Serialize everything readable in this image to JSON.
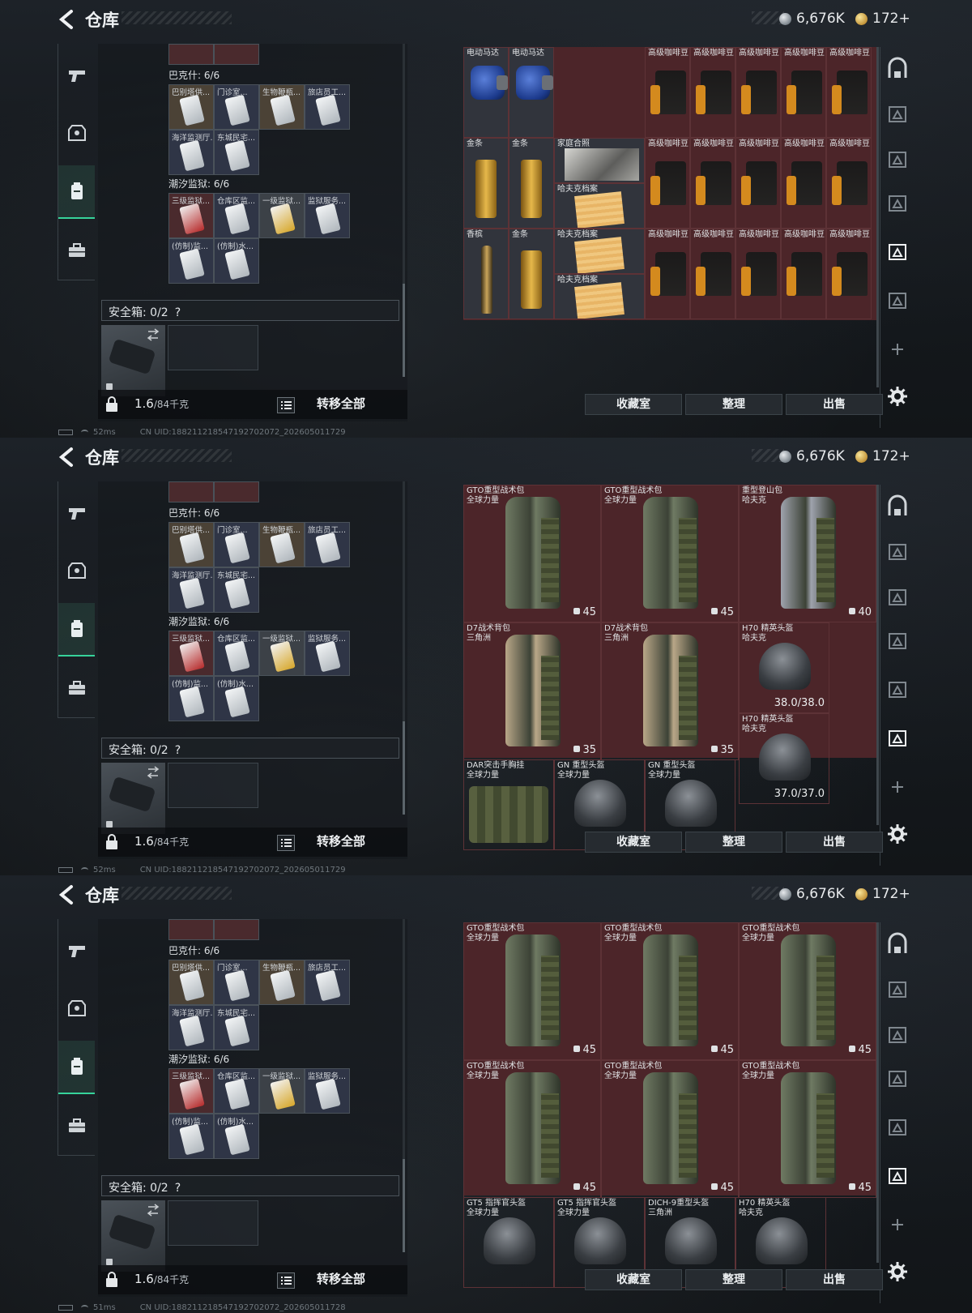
{
  "header": {
    "title": "仓库",
    "silver": "6,676K",
    "gold": "172+"
  },
  "storage": {
    "group_a": "巴克什: 6/6",
    "group_a_items": [
      "巴别塔供...",
      "门诊室...",
      "生物鞭瓶...",
      "旅店员工...",
      "海洋监测厅...",
      "东城民宅..."
    ],
    "group_b": "潮汐监狱: 6/6",
    "group_b_items": [
      "三级监狱...",
      "仓库区监...",
      "一级监狱...",
      "监狱服务...",
      "(仿制)监...",
      "(仿制)水..."
    ],
    "safe_label": "安全箱: 0/2",
    "safe_help": "?",
    "weight": "1.6",
    "weight_max": "/84千克",
    "transfer": "转移全部"
  },
  "actions": {
    "collect": "收藏室",
    "sort": "整理",
    "sell": "出售"
  },
  "panels": [
    {
      "status": "52ms",
      "uid": "CN UID:188211218547192702072_202605011729",
      "items": {
        "motor": "电动马达",
        "coffee": "高级咖啡豆",
        "gold": "金条",
        "photo": "家庭合照",
        "hafu": "哈夫克档案",
        "champagne": "香槟"
      }
    },
    {
      "status": "52ms",
      "uid": "CN UID:188211218547192702072_202605011729",
      "items": [
        {
          "name": "GTO重型战术包",
          "sub": "全球力量",
          "num": "45"
        },
        {
          "name": "GTO重型战术包",
          "sub": "全球力量",
          "num": "45"
        },
        {
          "name": "重型登山包",
          "sub": "哈夫克",
          "num": "40"
        },
        {
          "name": "D7战术背包",
          "sub": "三角洲",
          "num": "35"
        },
        {
          "name": "D7战术背包",
          "sub": "三角洲",
          "num": "35"
        },
        {
          "name": "H70 精英头盔",
          "sub": "哈夫克",
          "num": "38.0/38.0"
        },
        {
          "name": "H70 精英头盔",
          "sub": "哈夫克",
          "num": "37.0/37.0"
        },
        {
          "name": "DAR突击手胸挂",
          "sub": "全球力量"
        },
        {
          "name": "GN 重型头盔",
          "sub": "全球力量"
        },
        {
          "name": "GN 重型头盔",
          "sub": "全球力量"
        }
      ]
    },
    {
      "status": "51ms",
      "uid": "CN UID:188211218547192702072_202605011728",
      "items": [
        {
          "name": "GTO重型战术包",
          "sub": "全球力量",
          "num": "45"
        },
        {
          "name": "GTO重型战术包",
          "sub": "全球力量",
          "num": "45"
        },
        {
          "name": "GTO重型战术包",
          "sub": "全球力量",
          "num": "45"
        },
        {
          "name": "GTO重型战术包",
          "sub": "全球力量",
          "num": "45"
        },
        {
          "name": "GTO重型战术包",
          "sub": "全球力量",
          "num": "45"
        },
        {
          "name": "GTO重型战术包",
          "sub": "全球力量",
          "num": "45"
        },
        {
          "name": "GT5 指挥官头盔",
          "sub": "全球力量"
        },
        {
          "name": "GT5 指挥官头盔",
          "sub": "全球力量"
        },
        {
          "name": "DICH-9重型头盔",
          "sub": "三角洲"
        },
        {
          "name": "H70 精英头盔",
          "sub": "哈夫克"
        }
      ]
    }
  ],
  "colors": {
    "grid_bg": "#4c2529",
    "accent": "#36d39a"
  }
}
